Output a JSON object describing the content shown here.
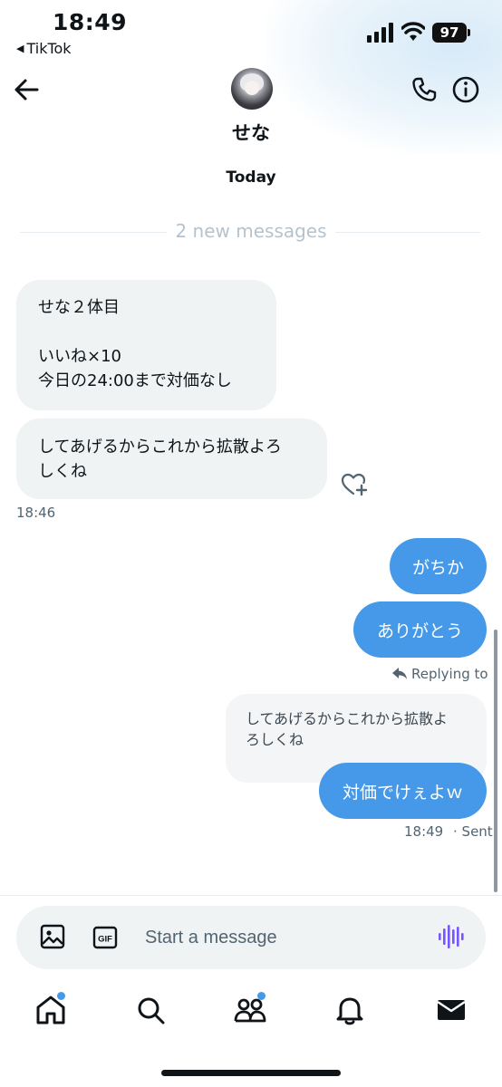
{
  "status_bar": {
    "time": "18:49",
    "back_app_label": "TikTok",
    "battery_level": "97"
  },
  "header": {
    "contact_name": "せな"
  },
  "conversation": {
    "date_label": "Today",
    "new_messages_label": "2 new messages",
    "incoming": [
      {
        "lines": [
          "せな２体目",
          "",
          "いいね×10",
          "今日の24:00まで対価なし"
        ]
      },
      {
        "lines": [
          "してあげるからこれから拡散よろ",
          "しくね"
        ]
      }
    ],
    "incoming_time": "18:46",
    "outgoing": [
      {
        "text": "がちか"
      },
      {
        "text": "ありがとう"
      }
    ],
    "replying_to_label": "Replying to",
    "quoted_message_lines": [
      "してあげるからこれから拡散よ",
      "ろしくね"
    ],
    "reply_text": "対価でけぇよｗ",
    "sent_time": "18:49",
    "sent_status": "· Sent"
  },
  "composer": {
    "placeholder": "Start a message"
  },
  "colors": {
    "accent": "#4599e8",
    "incoming_bubble": "#eff3f4",
    "voice_icon": "#7856ff"
  }
}
